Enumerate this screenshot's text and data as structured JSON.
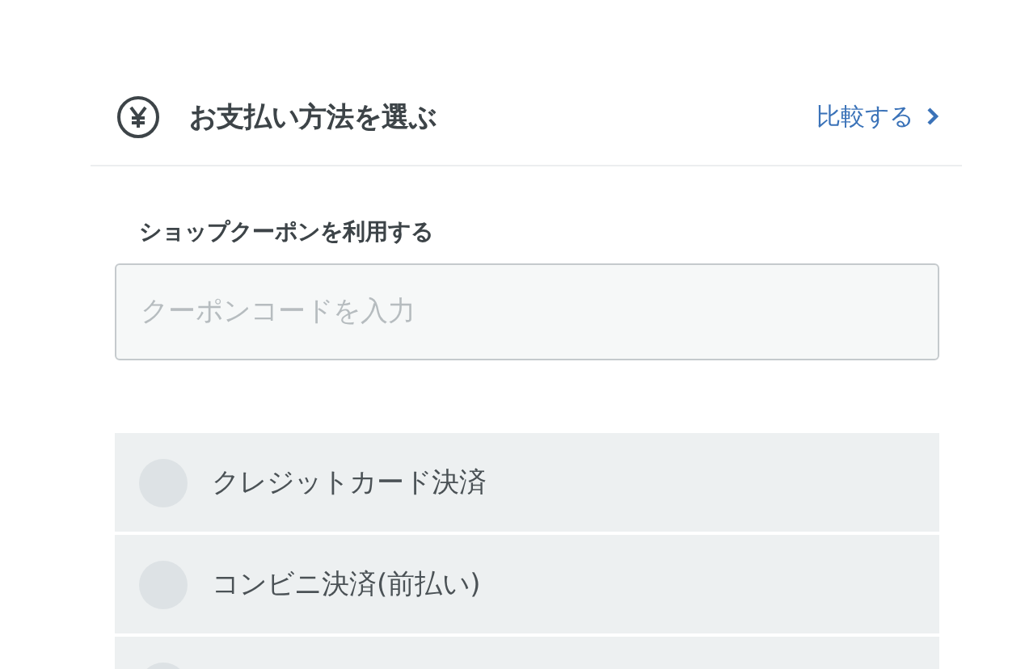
{
  "header": {
    "title": "お支払い方法を選ぶ",
    "compare_link": "比較する"
  },
  "coupon": {
    "label": "ショップクーポンを利用する",
    "placeholder": "クーポンコードを入力"
  },
  "payment_options": [
    {
      "label": "クレジットカード決済",
      "selected": false
    },
    {
      "label": "コンビニ決済(前払い)",
      "selected": false
    },
    {
      "selected": false
    }
  ]
}
